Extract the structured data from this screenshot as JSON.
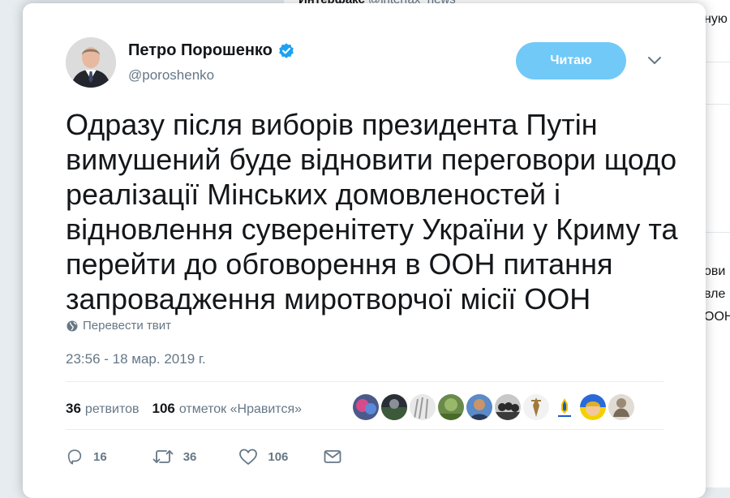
{
  "background": {
    "header_name": "Интерфакс",
    "header_handle": "@interfax_news",
    "fragments": [
      "ную",
      "ови",
      "вле",
      "ООН"
    ]
  },
  "tweet": {
    "author_name": "Петро Порошенко",
    "author_handle": "@poroshenko",
    "verified": true,
    "follow_label": "Читаю",
    "text": "Одразу після виборів президента Путін вимушений буде відновити переговори щодо реалізації Мінських домовленостей і відновлення суверенітету України у Криму та перейти до обговорення в ООН питання запровадження миротворчої місії ООН",
    "translate_label": "Перевести твит",
    "timestamp": "23:56 - 18 мар. 2019 г.",
    "stats": {
      "retweets_count": "36",
      "retweets_label": "ретвитов",
      "likes_count": "106",
      "likes_label": "отметок «Нравится»"
    },
    "actions": {
      "reply_count": "16",
      "retweet_count": "36",
      "like_count": "106"
    }
  },
  "icons": [
    "verified-badge-icon",
    "chevron-down-icon",
    "globe-icon",
    "reply-icon",
    "retweet-icon",
    "heart-icon",
    "direct-message-icon"
  ],
  "colors": {
    "accent": "#1da1f2",
    "follow_button": "#71c9f8",
    "text_primary": "#14171a",
    "text_secondary": "#657786",
    "backdrop": "#e6ecf0"
  }
}
